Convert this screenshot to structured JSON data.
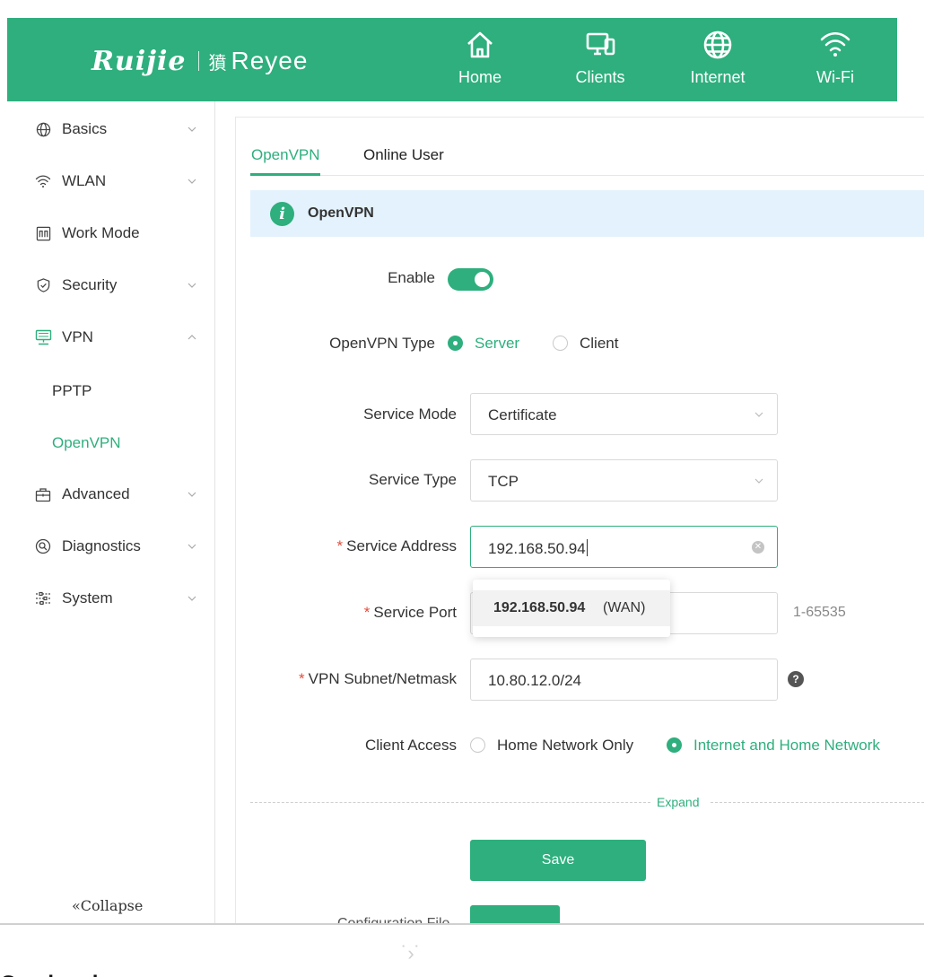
{
  "brand": {
    "ruijie": "Ruijie",
    "reyee": "Reyee",
    "reyee_glyph": "獖"
  },
  "topnav": [
    {
      "label": "Home",
      "icon": "home-icon"
    },
    {
      "label": "Clients",
      "icon": "monitor-icon"
    },
    {
      "label": "Internet",
      "icon": "globe-icon"
    },
    {
      "label": "Wi-Fi",
      "icon": "wifi-icon"
    }
  ],
  "sidebar": {
    "items": [
      {
        "label": "Basics",
        "icon": "globe-icon",
        "chevron": "down"
      },
      {
        "label": "WLAN",
        "icon": "wifi-icon",
        "chevron": "down"
      },
      {
        "label": "Work Mode",
        "icon": "work-mode-icon",
        "chevron": ""
      },
      {
        "label": "Security",
        "icon": "shield-icon",
        "chevron": "down"
      },
      {
        "label": "VPN",
        "icon": "vpn-icon",
        "chevron": "up"
      },
      {
        "label": "Advanced",
        "icon": "toolbox-icon",
        "chevron": "down"
      },
      {
        "label": "Diagnostics",
        "icon": "diagnostics-icon",
        "chevron": "down"
      },
      {
        "label": "System",
        "icon": "sliders-icon",
        "chevron": "down"
      }
    ],
    "vpn_sub": [
      {
        "label": "PPTP",
        "active": false
      },
      {
        "label": "OpenVPN",
        "active": true
      }
    ],
    "collapse": "«Collapse"
  },
  "tabs": [
    {
      "label": "OpenVPN",
      "active": true
    },
    {
      "label": "Online User",
      "active": false
    }
  ],
  "info": {
    "icon": "i",
    "title": "OpenVPN"
  },
  "form": {
    "enable": {
      "label": "Enable",
      "value": true
    },
    "openvpn_type": {
      "label": "OpenVPN Type",
      "options": [
        "Server",
        "Client"
      ],
      "selected": "Server"
    },
    "service_mode": {
      "label": "Service Mode",
      "value": "Certificate"
    },
    "service_type": {
      "label": "Service Type",
      "value": "TCP"
    },
    "service_address": {
      "label": "Service Address",
      "required": "*",
      "value": "192.168.50.94"
    },
    "service_port": {
      "label": "Service Port",
      "required": "*",
      "value": "",
      "hint": "1-65535"
    },
    "vpn_subnet": {
      "label": "VPN Subnet/Netmask",
      "required": "*",
      "value": "10.80.12.0/24",
      "help": "?"
    },
    "client_access": {
      "label": "Client Access",
      "options": [
        "Home Network Only",
        "Internet and Home Network"
      ],
      "selected": "Internet and Home Network"
    },
    "expand": "Expand",
    "save": "Save",
    "config_label": "Configuration File"
  },
  "autocomplete": {
    "ip": "192.168.50.94",
    "tag": "(WAN)"
  },
  "colors": {
    "accent": "#2eaf7d",
    "info_bg": "#e4f2fd",
    "required": "#e64c3c"
  },
  "footer": {
    "cursor_glyph": "˙›˙",
    "caption": "Go ahead"
  }
}
